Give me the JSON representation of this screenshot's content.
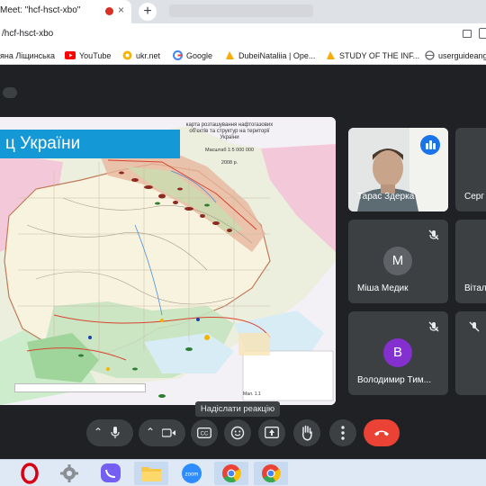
{
  "browser": {
    "tab_title": "Meet: \"hcf-hsct-xbo\"",
    "tab_close": "×",
    "new_tab": "+",
    "url": "/hcf-hsct-xbo"
  },
  "bookmarks": [
    {
      "label": "яна Ліщинська",
      "icon": "none",
      "color": ""
    },
    {
      "label": "YouTube",
      "icon": "youtube-icon",
      "color": "#ff0000"
    },
    {
      "label": "ukr.net",
      "icon": "ukrnet-icon",
      "color": "#f5b400"
    },
    {
      "label": "Google",
      "icon": "google-icon",
      "color": "#4285f4"
    },
    {
      "label": "DubeiNataliia | Ope...",
      "icon": "bookmark-folder-icon",
      "color": "#f9ab00"
    },
    {
      "label": "STUDY OF THE INF...",
      "icon": "bookmark-folder-icon",
      "color": "#f9ab00"
    },
    {
      "label": "userguideang",
      "icon": "globe-icon",
      "color": "#5f6368"
    }
  ],
  "presentation": {
    "title": "ц України",
    "legend_heading": "карта розташування нафтогазових об'єктів та структур на території України",
    "scale": "Масштаб 1:5 000 000",
    "year": "2008 р.",
    "note": "Мал. 1.1"
  },
  "participants": [
    {
      "name": "Тарас Здерка",
      "type": "video",
      "speaking": true
    },
    {
      "name": "Серг",
      "type": "empty"
    },
    {
      "name": "Міша Медик",
      "type": "avatar",
      "initial": "M",
      "avatar_color": "#5f6368",
      "muted": true
    },
    {
      "name": "Вітал",
      "type": "empty"
    },
    {
      "name": "Володимир Тим...",
      "type": "avatar",
      "initial": "B",
      "avatar_color": "#8430ce",
      "muted": true
    }
  ],
  "controls": {
    "tooltip": "Надіслати реакцію"
  },
  "colors": {
    "meet_bg": "#202124",
    "tile_bg": "#3c4043",
    "end_call": "#ea4335",
    "accent_blue": "#1a73e8",
    "slide_title_bg": "#1598d6"
  }
}
